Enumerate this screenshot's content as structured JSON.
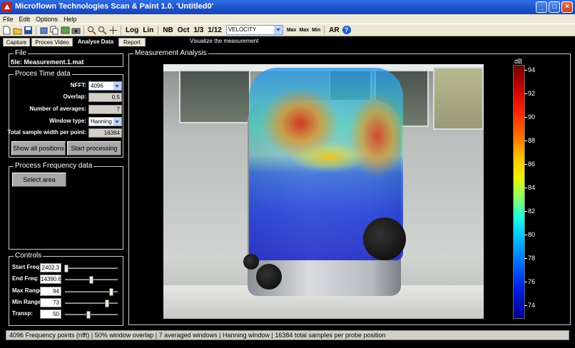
{
  "window": {
    "title": "Microflown Technologies Scan & Paint 1.0. 'Untitled0'",
    "buttons": [
      "_",
      "□",
      "×"
    ]
  },
  "menu": [
    "File",
    "Edit",
    "Options",
    "Help"
  ],
  "toolbar": {
    "log_label": "Log",
    "lin_label": "Lin",
    "nb_label": "NB",
    "oct_label": "Oct",
    "third_label": "1/3",
    "twelfth_label": "1/12",
    "quantity_select": "VELOCITY",
    "max_label": "Max",
    "max2_label": "Max",
    "min_label": "Min",
    "ar_label": "AR",
    "help_label": "?"
  },
  "tabs": [
    {
      "label": "Capture",
      "active": false
    },
    {
      "label": "Proces Video",
      "active": false
    },
    {
      "label": "Analyse Data",
      "active": true
    },
    {
      "label": "Report",
      "active": false
    }
  ],
  "tab_hint": "Visualize the measurement",
  "file_group": {
    "title": "File",
    "file_label": "file: Measurement.1.mat"
  },
  "proces_time": {
    "title": "Proces Time data",
    "fields": [
      {
        "label": "NFFT:",
        "value": "4096",
        "type": "select"
      },
      {
        "label": "Overlap:",
        "value": "0.5",
        "type": "value"
      },
      {
        "label": "Number of averages:",
        "value": "7",
        "type": "value"
      },
      {
        "label": "Window type:",
        "value": "Hanning",
        "type": "select"
      },
      {
        "label": "Total sample width per point:",
        "value": "16384",
        "type": "value"
      }
    ],
    "show_all_button": "Show all positions",
    "start_processing_button": "Start processing"
  },
  "process_freq": {
    "title": "Process Frequency data",
    "select_area_button": "Select area"
  },
  "controls": {
    "title": "Controls",
    "rows": [
      {
        "label": "Start Freq:",
        "value": "2402.3",
        "level": 0.03
      },
      {
        "label": "End Freq:",
        "value": "14390.6",
        "level": 0.5
      },
      {
        "label": "Max Range:",
        "value": "94",
        "level": 0.88
      },
      {
        "label": "Min Range:",
        "value": "73",
        "level": 0.8
      },
      {
        "label": "Transp:",
        "value": "50",
        "level": 0.45
      }
    ]
  },
  "analysis": {
    "title": "Measurement Analysis"
  },
  "colorbar": {
    "unit": "dB",
    "ticks": [
      "94",
      "92",
      "90",
      "88",
      "86",
      "84",
      "82",
      "80",
      "78",
      "76",
      "74"
    ],
    "min": 73,
    "max": 94
  },
  "statusbar": {
    "text": "4096 Frequency points (nfft)  |  50% window overlap  |  7 averaged windows  |  Hanning window  |  16384 total samples per probe position"
  },
  "colors": {
    "titlebar": "#1b50c8",
    "background": "#000000",
    "panel": "#ece9d8"
  }
}
